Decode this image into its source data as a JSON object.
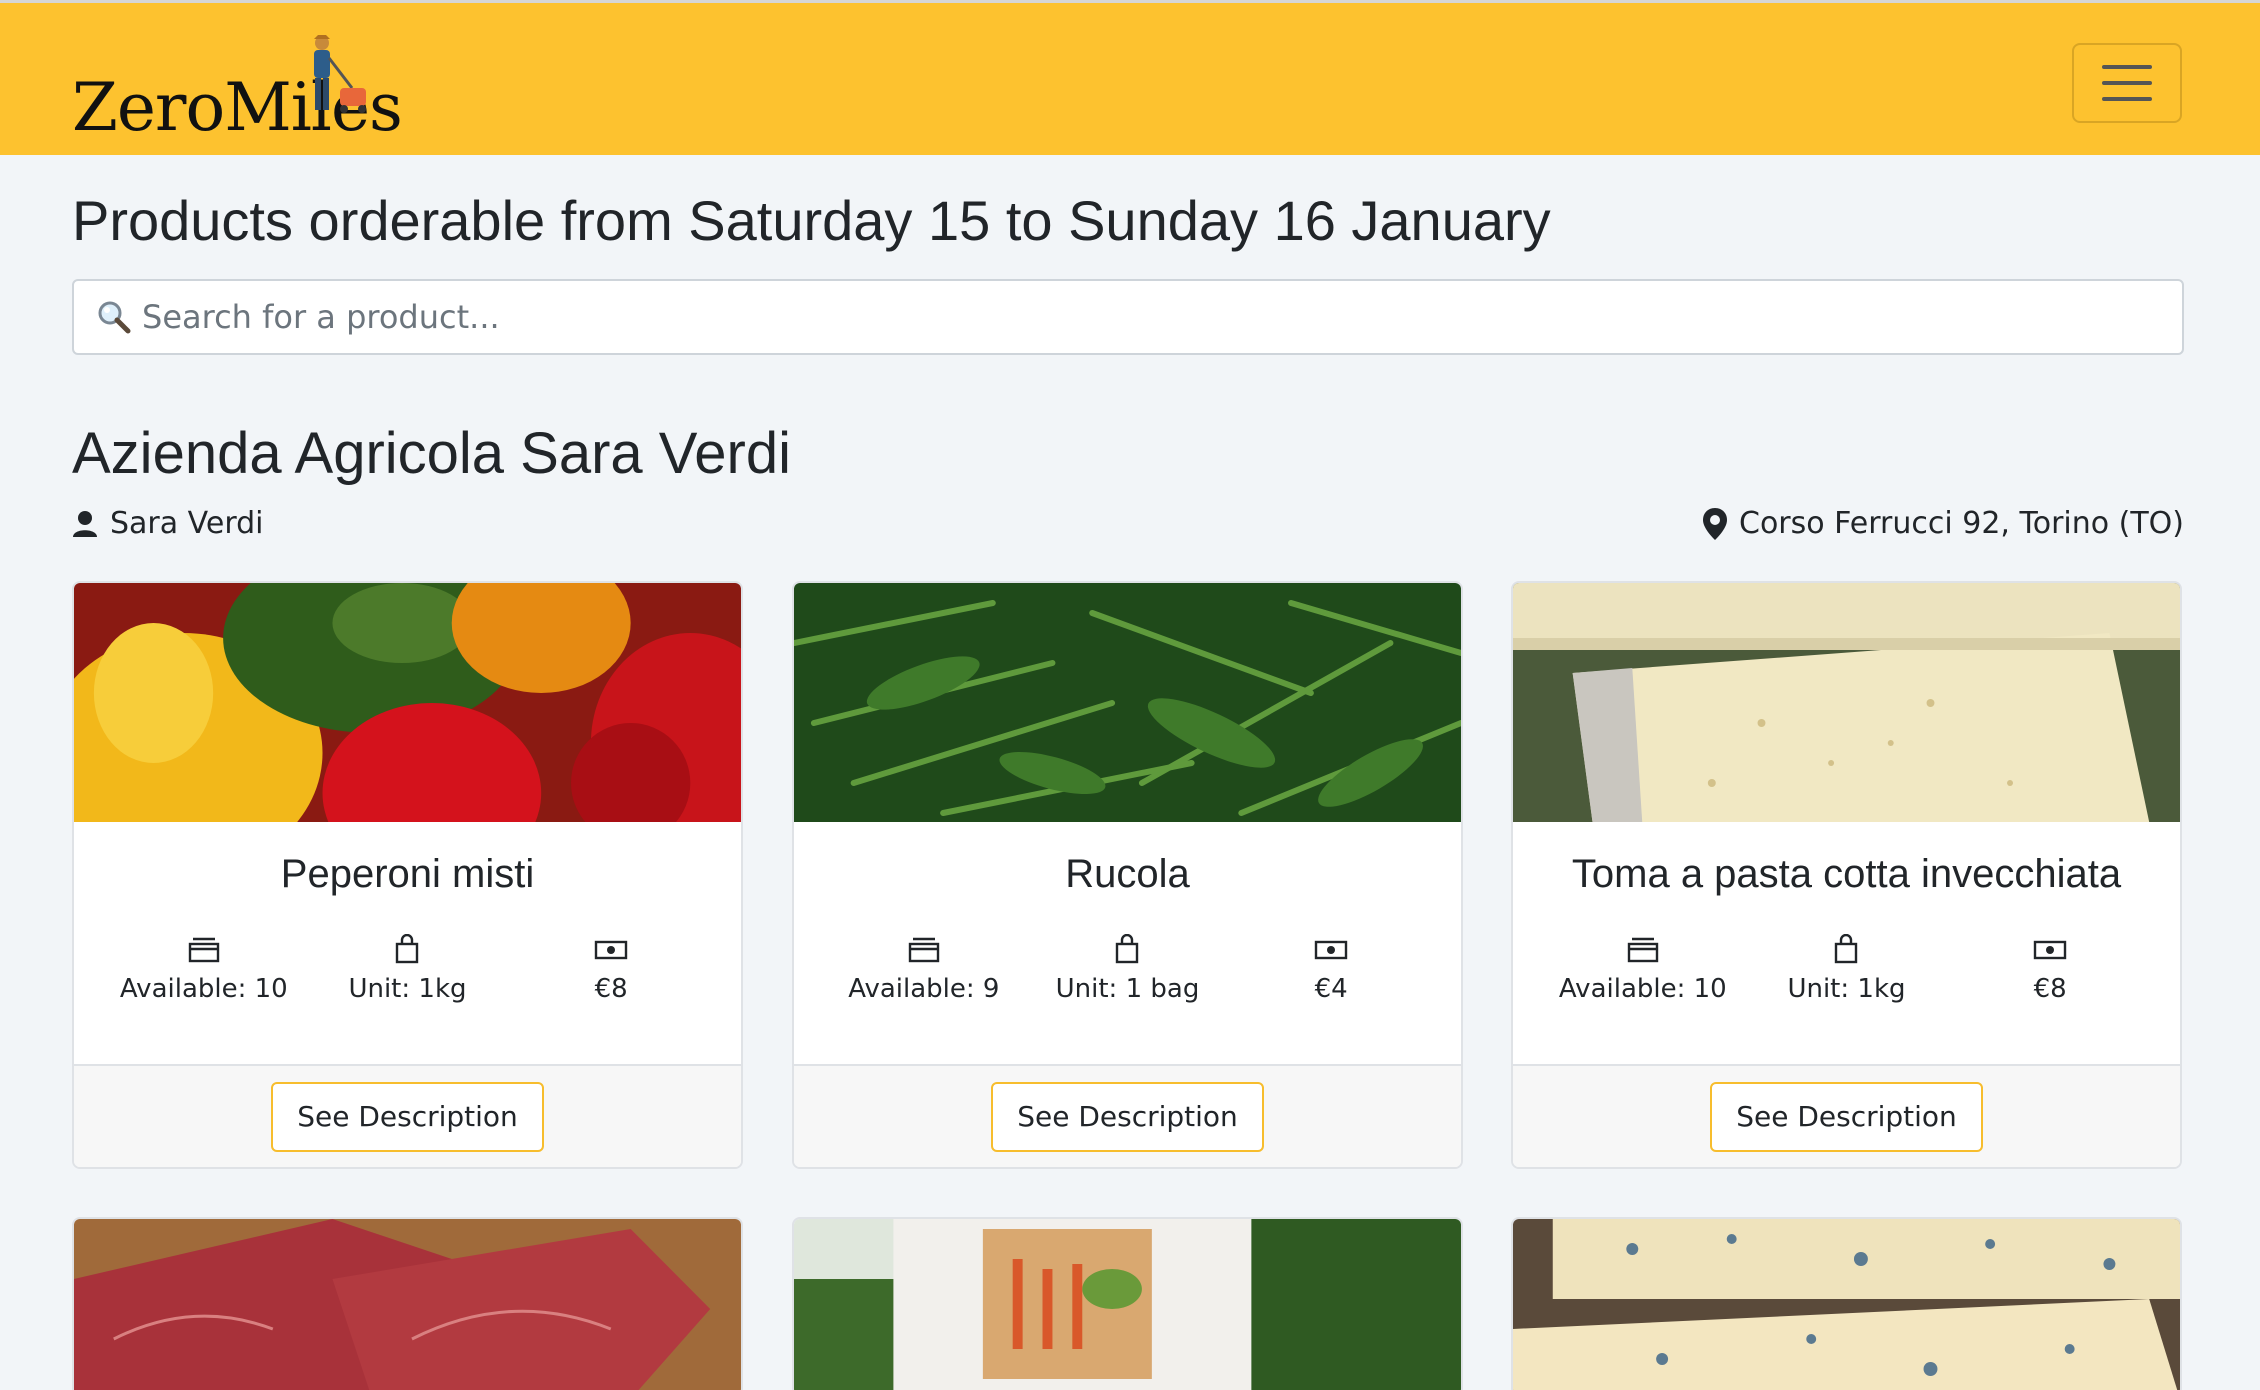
{
  "navbar": {
    "brand": "ZeroMiles",
    "brand_color": "#fdc22f",
    "menu_icon": "hamburger-icon"
  },
  "page": {
    "title": "Products orderable from Saturday 15 to Sunday 16 January"
  },
  "search": {
    "placeholder": "Search for a product...",
    "value": "",
    "icon": "magnifier-icon"
  },
  "farm": {
    "name": "Azienda Agricola Sara Verdi",
    "farmer": "Sara Verdi",
    "address": "Corso Ferrucci 92, Torino (TO)"
  },
  "products": [
    {
      "name": "Peperoni misti",
      "available": "Available: 10",
      "unit": "Unit: 1kg",
      "price": "€8",
      "button": "See Description"
    },
    {
      "name": "Rucola",
      "available": "Available: 9",
      "unit": "Unit: 1 bag",
      "price": "€4",
      "button": "See Description"
    },
    {
      "name": "Toma a pasta cotta invecchiata",
      "available": "Available: 10",
      "unit": "Unit: 1kg",
      "price": "€8",
      "button": "See Description"
    }
  ],
  "accent_color": "#f7bd2d"
}
